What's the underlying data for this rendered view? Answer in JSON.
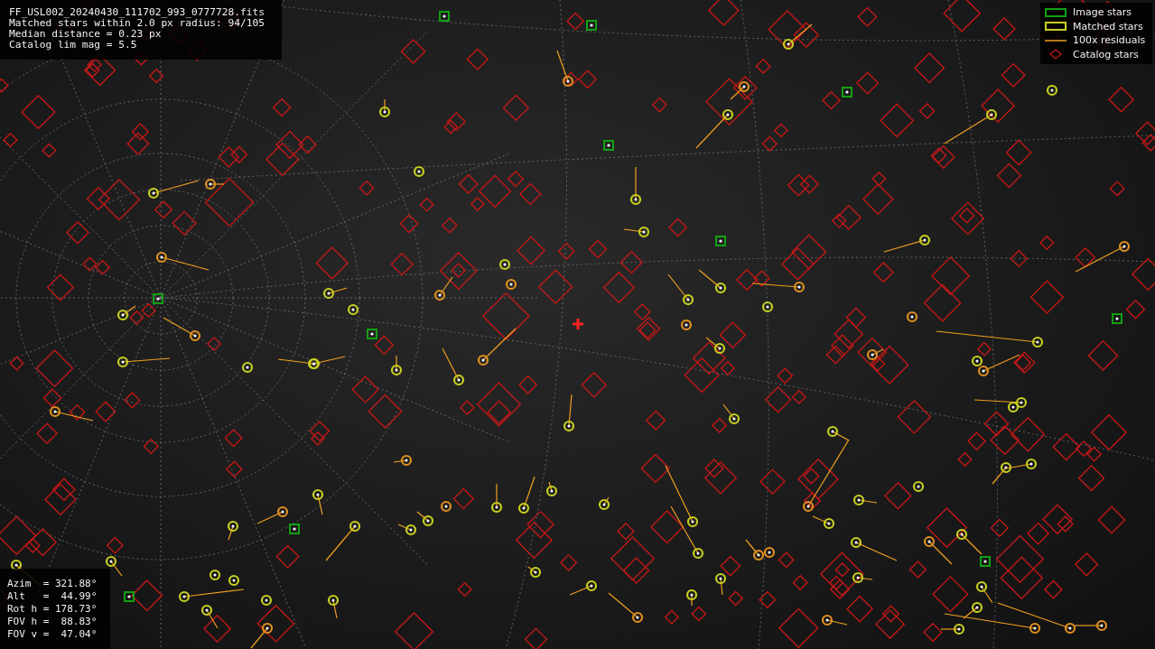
{
  "header": {
    "lines": [
      "FF_USL002_20240430_111702_993_0777728.fits",
      "Matched stars within 2.0 px radius: 94/105",
      "Median distance = 0.23 px",
      "Catalog lim mag = 5.5"
    ]
  },
  "legend": [
    {
      "kind": "image",
      "label": "Image stars"
    },
    {
      "kind": "matched",
      "label": "Matched stars"
    },
    {
      "kind": "residual",
      "label": "100x residuals"
    },
    {
      "kind": "catalog",
      "label": "Catalog stars"
    }
  ],
  "pointing": {
    "lines": [
      "Azim  = 321.88°",
      "Alt   =  44.99°",
      "Rot h = 178.73°",
      "FOV h =  88.83°",
      "FOV v =  47.04°"
    ]
  }
}
